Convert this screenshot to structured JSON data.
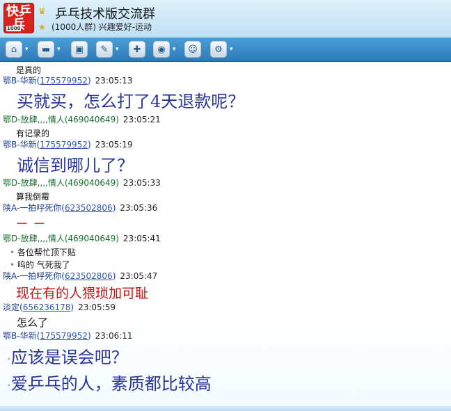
{
  "group": {
    "title": "乒乓技术版交流群",
    "subtitle": "(1000人群) 兴趣爱好-运动",
    "logo_text": "快乒乓",
    "logo_badge": "1000"
  },
  "messages": [
    {
      "type": "text",
      "text": "是真的"
    },
    {
      "type": "meta",
      "name": "鄂B-华新(",
      "uid": "175579952",
      "close": ")",
      "time": "23:05:13",
      "color": "blue"
    },
    {
      "type": "big",
      "text": "买就买，怎么打了4天退款呢？"
    },
    {
      "type": "meta",
      "name": "鄂D-放肆,,,,情人(",
      "uid": "469040649",
      "close": ")",
      "time": "23:05:21",
      "color": "green",
      "uid_plain": true
    },
    {
      "type": "text",
      "text": "有记录的"
    },
    {
      "type": "meta",
      "name": "鄂B-华新(",
      "uid": "175579952",
      "close": ")",
      "time": "23:05:19",
      "color": "blue"
    },
    {
      "type": "big",
      "text": "诚信到哪儿了？"
    },
    {
      "type": "meta",
      "name": "鄂D-放肆,,,,情人(",
      "uid": "469040649",
      "close": ")",
      "time": "23:05:33",
      "color": "green",
      "uid_plain": true
    },
    {
      "type": "text",
      "text": "算我倒霉"
    },
    {
      "type": "meta",
      "name": "陕A-一拍呼死你(",
      "uid": "623502806",
      "close": ")",
      "time": "23:05:36",
      "color": "blue"
    },
    {
      "type": "red",
      "text": "－ －"
    },
    {
      "type": "meta",
      "name": "鄂D-放肆,,,,情人(",
      "uid": "469040649",
      "close": ")",
      "time": "23:05:41",
      "color": "green",
      "uid_plain": true
    },
    {
      "type": "text",
      "text": "各位帮忙顶下贴"
    },
    {
      "type": "text",
      "text": "呜的 气死我了"
    },
    {
      "type": "meta",
      "name": "陕A-一拍呼死你(",
      "uid": "623502806",
      "close": ")",
      "time": "23:05:47",
      "color": "blue"
    },
    {
      "type": "red",
      "text": "现在有的人猥琐加可耻"
    },
    {
      "type": "meta",
      "name": "淡定(",
      "uid": "656236178",
      "close": ")",
      "time": "23:05:59",
      "color": "blue"
    },
    {
      "type": "text",
      "text": "怎么了"
    },
    {
      "type": "meta",
      "name": "鄂B-华新(",
      "uid": "175579952",
      "close": ")",
      "time": "23:06:11",
      "color": "blue"
    },
    {
      "type": "big",
      "text": "应该是误会吧？"
    },
    {
      "type": "big",
      "text": "爱乒乓的人，素质都比较高"
    }
  ],
  "toolbar": [
    {
      "icon": "home-icon",
      "label": "⌂"
    },
    {
      "icon": "folder-icon",
      "label": "▬"
    },
    {
      "icon": "album-icon",
      "label": "▣"
    },
    {
      "icon": "talk-icon",
      "label": "✎"
    },
    {
      "icon": "note-add-icon",
      "label": "✚"
    },
    {
      "icon": "camera-icon",
      "label": "◉"
    },
    {
      "icon": "user-icon",
      "label": "☺"
    },
    {
      "icon": "gear-icon",
      "label": "⚙"
    }
  ]
}
